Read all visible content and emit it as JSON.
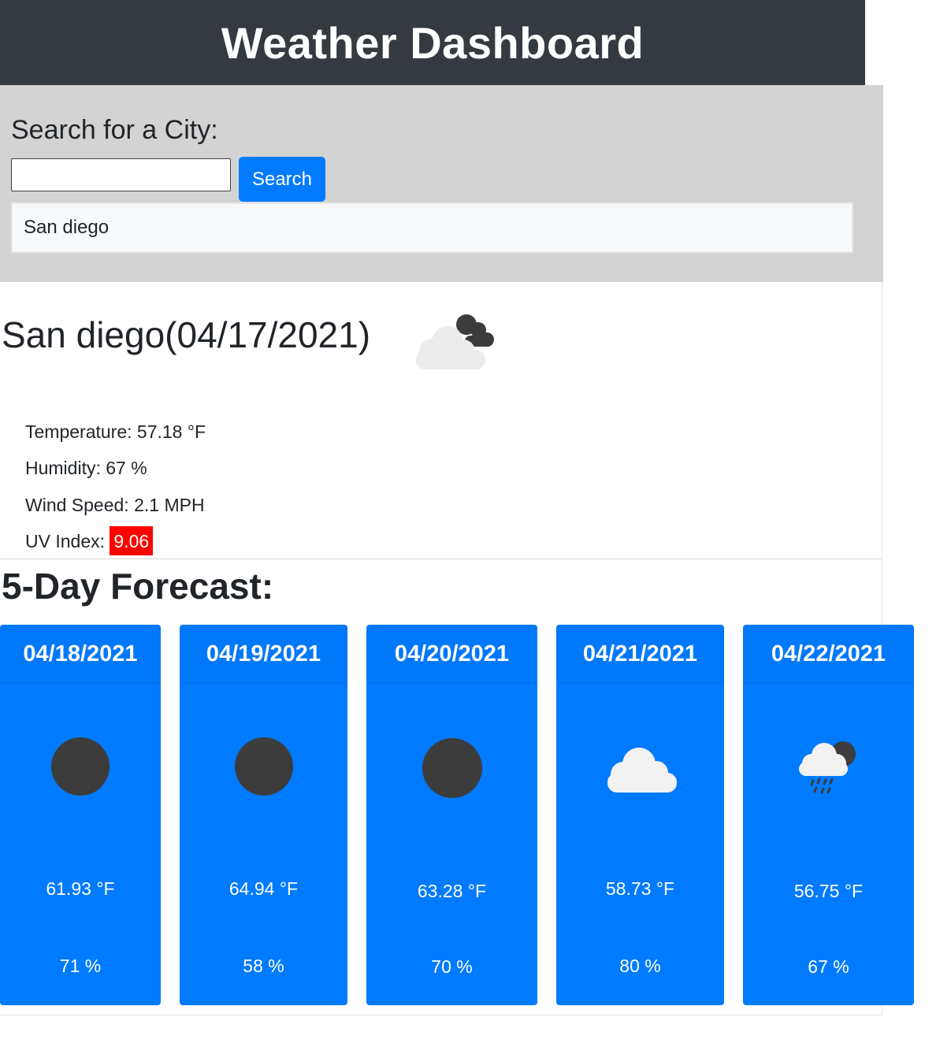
{
  "header": {
    "title": "Weather Dashboard"
  },
  "search": {
    "heading": "Search for a City:",
    "input_value": "",
    "button_label": "Search",
    "history": [
      "San diego"
    ]
  },
  "current": {
    "title": "San diego(04/17/2021)",
    "icon": "few-clouds-night-icon",
    "temperature": "Temperature: 57.18 °F",
    "humidity": "Humidity: 67 %",
    "wind": "Wind Speed: 2.1 MPH",
    "uv_label": "UV Index: ",
    "uv_value": "9.06",
    "uv_color": "#ff0000"
  },
  "forecast": {
    "heading": "5-Day Forecast:",
    "accent": "#007bff",
    "days": [
      {
        "date": "04/18/2021",
        "icon": "clear-night-icon",
        "temp": "61.93 °F",
        "humidity": "71 %"
      },
      {
        "date": "04/19/2021",
        "icon": "clear-night-icon",
        "temp": "64.94 °F",
        "humidity": "58 %"
      },
      {
        "date": "04/20/2021",
        "icon": "clear-night-icon",
        "temp": "63.28 °F",
        "humidity": "70 %"
      },
      {
        "date": "04/21/2021",
        "icon": "cloud-icon",
        "temp": "58.73 °F",
        "humidity": "80 %"
      },
      {
        "date": "04/22/2021",
        "icon": "rain-night-icon",
        "temp": "56.75 °F",
        "humidity": "67 %"
      }
    ]
  }
}
